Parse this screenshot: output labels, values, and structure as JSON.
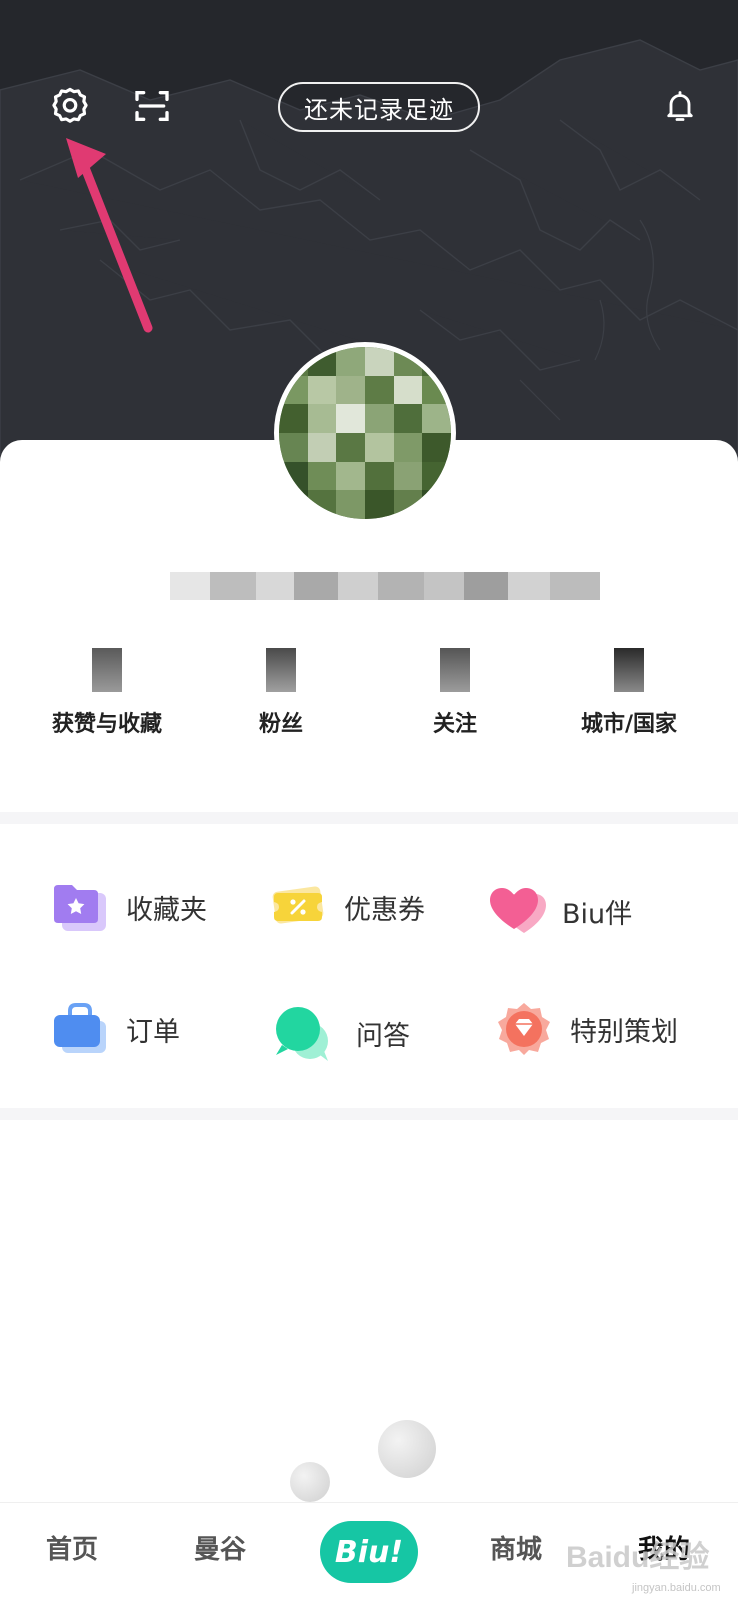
{
  "header": {
    "footprint_label": "还未记录足迹",
    "icons": [
      "gear-icon",
      "scan-icon",
      "bell-icon"
    ]
  },
  "profile": {
    "stats": [
      {
        "label": "获赞与收藏"
      },
      {
        "label": "粉丝"
      },
      {
        "label": "关注"
      },
      {
        "label": "城市/国家"
      }
    ]
  },
  "shortcuts": [
    {
      "label": "收藏夹",
      "icon": "folder-star-icon"
    },
    {
      "label": "优惠券",
      "icon": "coupon-icon"
    },
    {
      "label": "Biu伴",
      "icon": "heart-icon"
    },
    {
      "label": "订单",
      "icon": "bag-icon"
    },
    {
      "label": "问答",
      "icon": "chat-bubble-icon"
    },
    {
      "label": "特别策划",
      "icon": "diamond-badge-icon"
    }
  ],
  "bottom_nav": {
    "items": [
      {
        "label": "首页"
      },
      {
        "label": "曼谷"
      },
      {
        "label": "Biu!"
      },
      {
        "label": "商城"
      },
      {
        "label": "我的"
      }
    ],
    "active": "我的"
  },
  "watermark": {
    "text": "Baidu经验",
    "sub": "jingyan.baidu.com"
  },
  "colors": {
    "header_bg": "#25272c",
    "accent": "#16c6a4",
    "arrow": "#e03a72"
  }
}
